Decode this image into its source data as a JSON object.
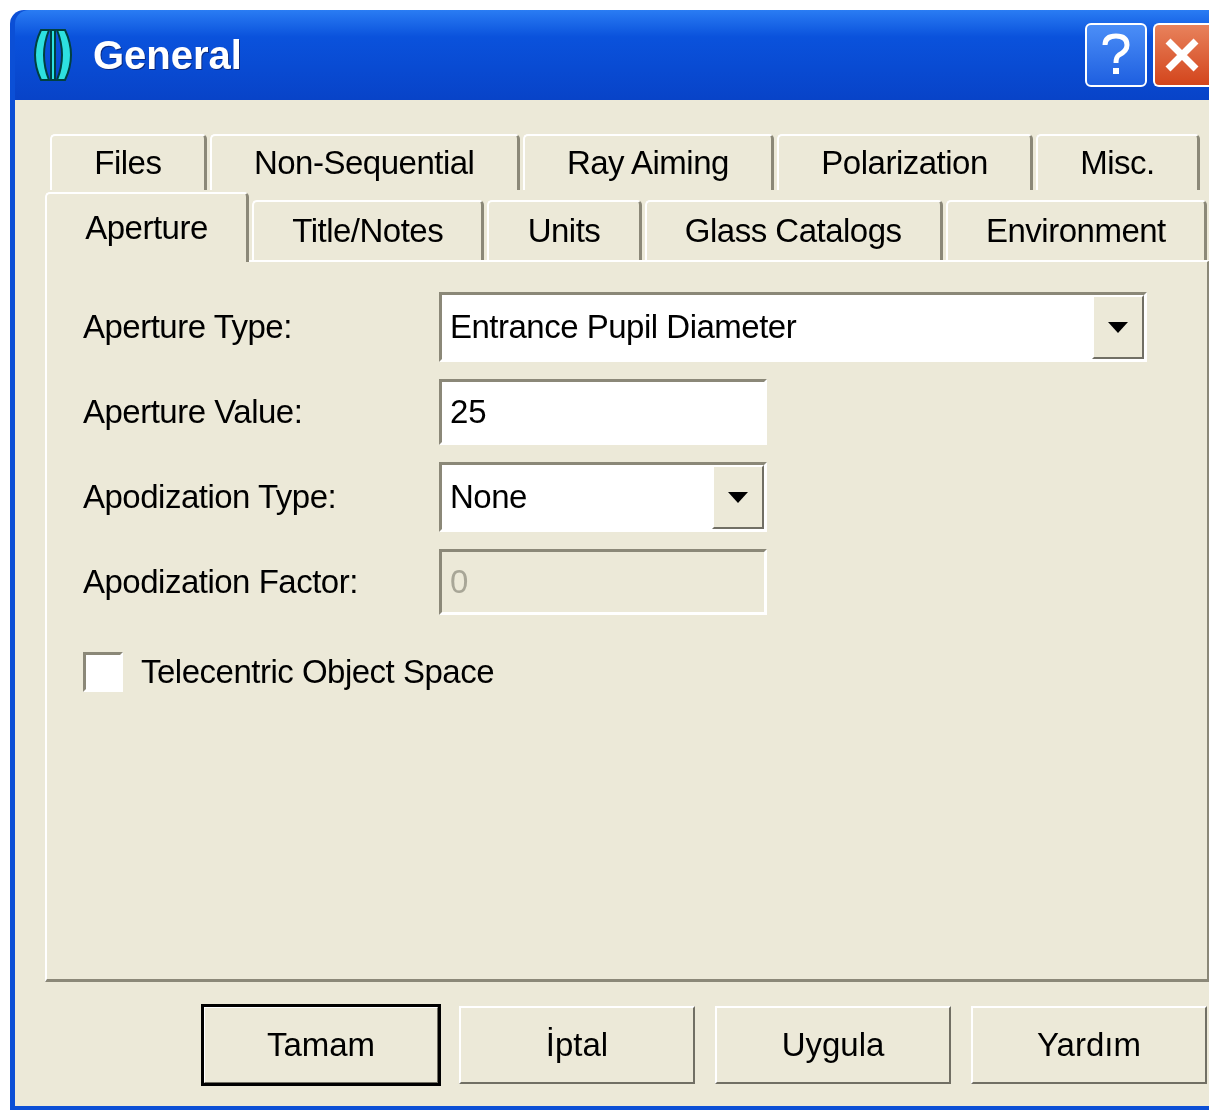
{
  "window": {
    "title": "General"
  },
  "tab_rows": [
    {
      "tabs": [
        {
          "label": "Files",
          "selected": false
        },
        {
          "label": "Non-Sequential",
          "selected": false
        },
        {
          "label": "Ray Aiming",
          "selected": false
        },
        {
          "label": "Polarization",
          "selected": false
        },
        {
          "label": "Misc.",
          "selected": false
        }
      ]
    },
    {
      "tabs": [
        {
          "label": "Aperture",
          "selected": true
        },
        {
          "label": "Title/Notes",
          "selected": false
        },
        {
          "label": "Units",
          "selected": false
        },
        {
          "label": "Glass Catalogs",
          "selected": false
        },
        {
          "label": "Environment",
          "selected": false
        }
      ]
    }
  ],
  "fields": [
    {
      "kind": "dropdown",
      "label": "Aperture Type:",
      "value": "Entrance Pupil Diameter",
      "disabled": false
    },
    {
      "kind": "text",
      "label": "Aperture Value:",
      "value": "25",
      "disabled": false
    },
    {
      "kind": "dropdown",
      "label": "Apodization Type:",
      "value": "None",
      "disabled": false
    },
    {
      "kind": "text",
      "label": "Apodization Factor:",
      "value": "0",
      "disabled": true
    }
  ],
  "checkbox": {
    "label": "Telecentric Object Space",
    "checked": false
  },
  "buttons": [
    {
      "label": "Tamam",
      "default": true
    },
    {
      "label": "İptal",
      "default": false
    },
    {
      "label": "Uygula",
      "default": false
    },
    {
      "label": "Yardım",
      "default": false
    }
  ]
}
